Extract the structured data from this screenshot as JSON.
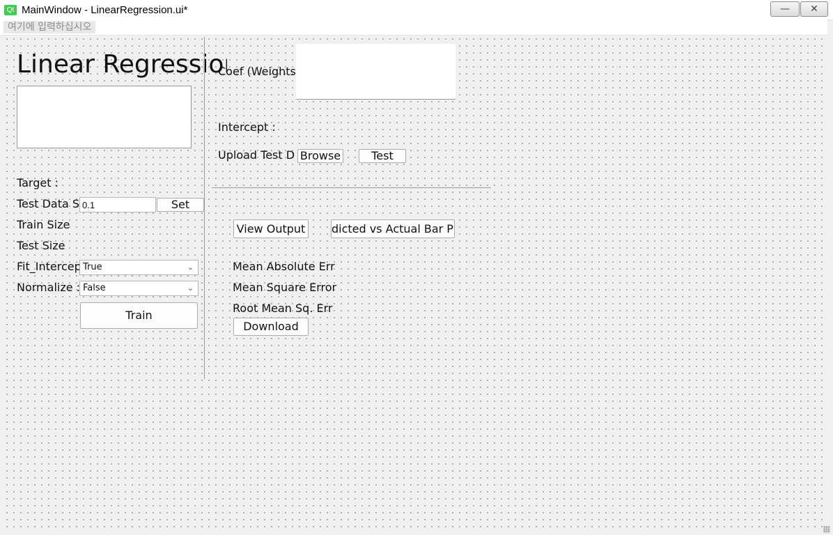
{
  "window": {
    "logo_text": "Qt",
    "title": "MainWindow - LinearRegression.ui*",
    "minimize_glyph": "—",
    "close_glyph": "✕"
  },
  "menubar": {
    "placeholder": "여기에 입력하십시오"
  },
  "left": {
    "title": "Linear Regressior",
    "target_label": "Target :",
    "test_data_label": "Test Data S",
    "test_data_value": "0.1",
    "set_button": "Set",
    "train_size_label": "Train Size",
    "test_size_label": "Test Size",
    "fit_intercept_label": "Fit_Intercep",
    "fit_intercept_value": "True",
    "normalize_label": "Normalize :",
    "normalize_value": "False",
    "train_button": "Train"
  },
  "right": {
    "coef_label": "Coef (Weights",
    "intercept_label": "Intercept :",
    "upload_label": "Upload Test D",
    "browse_button": "Browse",
    "test_button": "Test",
    "view_output_button": "View Output",
    "predicted_button": "dicted vs Actual Bar P",
    "mae_label": "Mean Absolute Err",
    "mse_label": "Mean Square Error",
    "rmse_label": "Root Mean Sq. Err",
    "download_button": "Download"
  }
}
